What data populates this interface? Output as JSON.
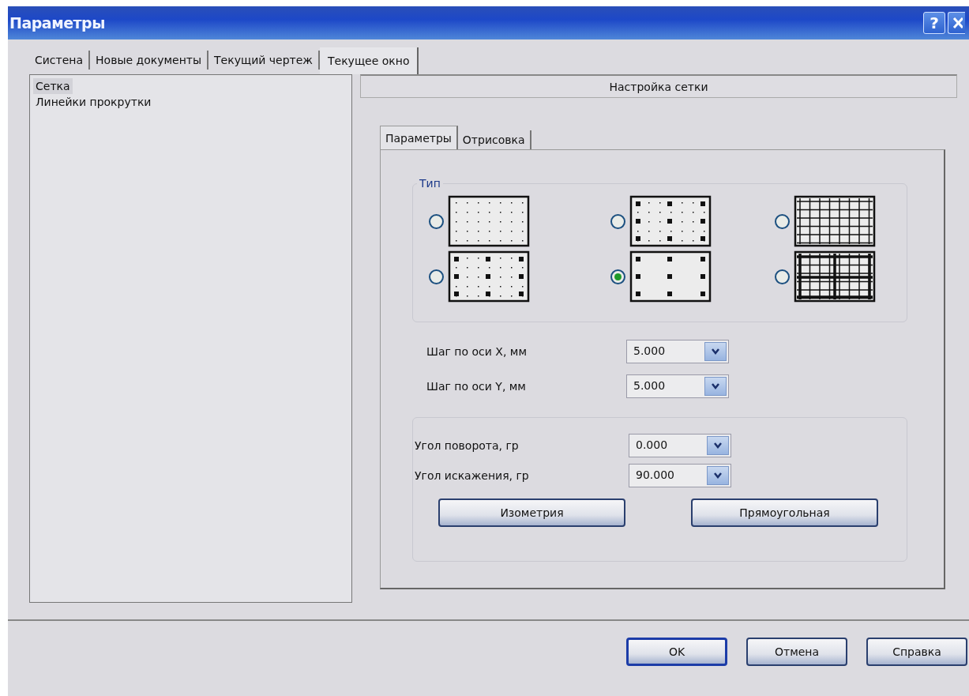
{
  "window": {
    "title": "Параметры",
    "help_button": "?"
  },
  "tabs": [
    {
      "label": "Систена",
      "selected": false
    },
    {
      "label": "Новые документы",
      "selected": false
    },
    {
      "label": "Текущий чертеж",
      "selected": false
    },
    {
      "label": "Текущее окно",
      "selected": true
    }
  ],
  "sidebar": {
    "items": [
      {
        "label": "Сетка",
        "selected": true
      },
      {
        "label": "Линейки прокрутки",
        "selected": false
      }
    ]
  },
  "section_header": "Настройка сетки",
  "inner_tabs": [
    {
      "label": "Параметры",
      "selected": true
    },
    {
      "label": "Отрисовка",
      "selected": false
    }
  ],
  "type_group": {
    "title": "Тип",
    "options": [
      {
        "kind": "dots",
        "selected": false
      },
      {
        "kind": "dots-major",
        "selected": false
      },
      {
        "kind": "lines",
        "selected": false
      },
      {
        "kind": "dots-major",
        "selected": false
      },
      {
        "kind": "dots-sparse",
        "selected": true
      },
      {
        "kind": "lines-major",
        "selected": false
      }
    ]
  },
  "step_fields": [
    {
      "label": "Шаг по оси  X, мм",
      "value": "5.000"
    },
    {
      "label": "Шаг по оси  Y, мм",
      "value": "5.000"
    }
  ],
  "angle_fields": [
    {
      "label": "Угол поворота, гр",
      "value": "0.000"
    },
    {
      "label": "Угол искажения, гр",
      "value": "90.000"
    }
  ],
  "preset_buttons": [
    "Изометрия",
    "Прямоугольная"
  ],
  "buttons": [
    {
      "label": "OK",
      "default": true
    },
    {
      "label": "Отмена",
      "default": false
    },
    {
      "label": "Справка",
      "default": false
    }
  ]
}
